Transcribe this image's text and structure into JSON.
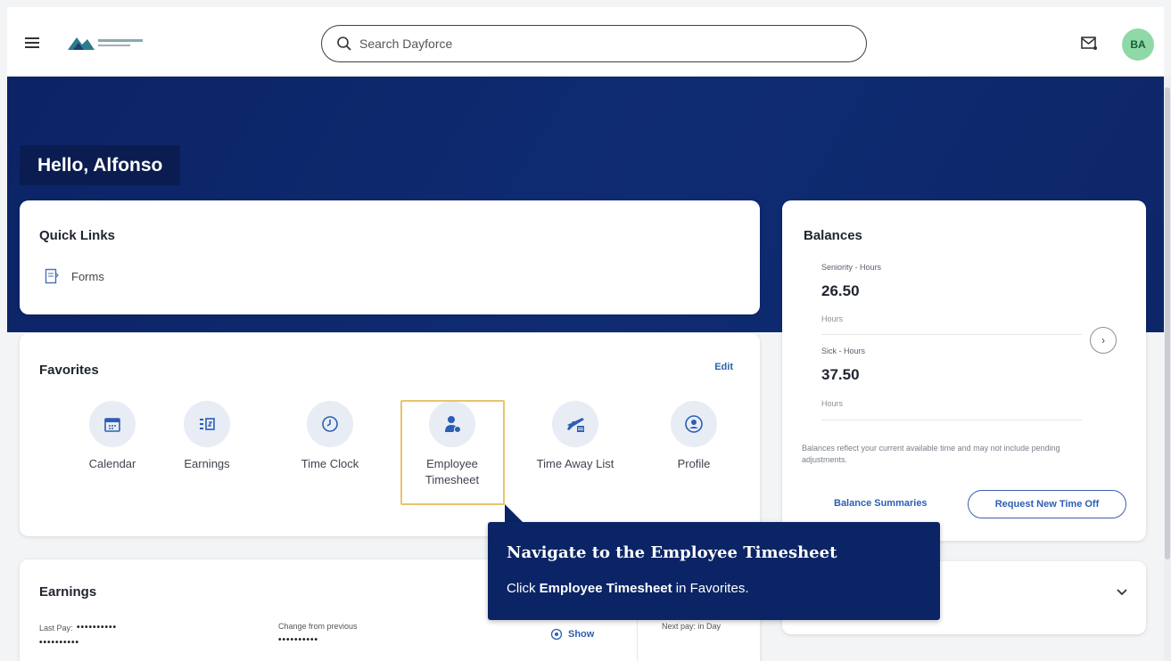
{
  "header": {
    "search_placeholder": "Search Dayforce",
    "avatar_initials": "BA"
  },
  "greeting": "Hello, Alfonso",
  "quick_links": {
    "title": "Quick Links",
    "items": [
      {
        "label": "Forms",
        "icon": "form-icon"
      }
    ]
  },
  "favorites": {
    "title": "Favorites",
    "edit_label": "Edit",
    "items": [
      {
        "label": "Calendar",
        "icon": "calendar-icon"
      },
      {
        "label": "Earnings",
        "icon": "earnings-icon"
      },
      {
        "label": "Time Clock",
        "icon": "clock-icon"
      },
      {
        "label": "Employee Timesheet",
        "icon": "timesheet-icon"
      },
      {
        "label": "Time Away List",
        "icon": "plane-icon"
      },
      {
        "label": "Profile",
        "icon": "profile-icon"
      }
    ]
  },
  "balances": {
    "title": "Balances",
    "items": [
      {
        "label": "Seniority - Hours",
        "value": "26.50",
        "unit": "Hours"
      },
      {
        "label": "Sick - Hours",
        "value": "37.50",
        "unit": "Hours"
      }
    ],
    "note": "Balances reflect your current available time and may not include pending adjustments.",
    "summaries_label": "Balance Summaries",
    "request_label": "Request New Time Off"
  },
  "earnings": {
    "title": "Earnings",
    "last_pay_label": "Last Pay:",
    "last_pay_mask": "••••••••••",
    "last_pay_mask2": "••••••••••",
    "change_label": "Change from previous",
    "change_mask": "••••••••••",
    "show_label": "Show",
    "next_pay_label": "Next pay: in Day"
  },
  "tooltip": {
    "title": "Navigate to the Employee Timesheet",
    "body_prefix": "Click ",
    "body_bold": "Employee Timesheet",
    "body_suffix": " in Favorites."
  },
  "colors": {
    "hero": "#0f2b72",
    "accent": "#2b5fb4",
    "highlight": "#e9c46a",
    "avatar": "#8fd9a8"
  }
}
